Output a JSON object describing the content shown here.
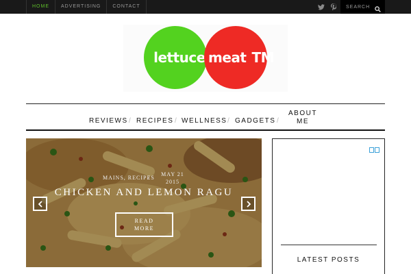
{
  "topbar": {
    "nav": [
      {
        "label": "HOME",
        "active": true
      },
      {
        "label": "ADVERTISING",
        "active": false
      },
      {
        "label": "CONTACT",
        "active": false
      }
    ],
    "social_icons": [
      "twitter-icon",
      "pinterest-icon"
    ],
    "search_placeholder": "SEARCH"
  },
  "logo": {
    "left_word": "lettuce",
    "right_word": "meat",
    "trademark": "TM",
    "colors": {
      "green": "#53d21f",
      "red": "#ee2a25"
    }
  },
  "main_nav": {
    "items": [
      "REVIEWS",
      "RECIPES",
      "WELLNESS",
      "GADGETS"
    ],
    "about": "ABOUT ME",
    "separator": "/"
  },
  "featured": {
    "date": "MAY 21 2015",
    "date_line1": "MAY 21",
    "date_line2": "2015",
    "categories": "MAINS, RECIPES",
    "slash": "/",
    "title": "CHICKEN AND LEMON RAGU",
    "read_more_line1": "READ",
    "read_more_line2": "MORE",
    "prev_icon": "chevron-left-icon",
    "next_icon": "chevron-right-icon"
  },
  "sidebar": {
    "ad_icon": "adchoices-icon",
    "latest_posts_title": "LATEST POSTS"
  },
  "colors": {
    "topbar_bg": "#191919",
    "active_nav": "#5fbf2a",
    "text": "#111111"
  }
}
